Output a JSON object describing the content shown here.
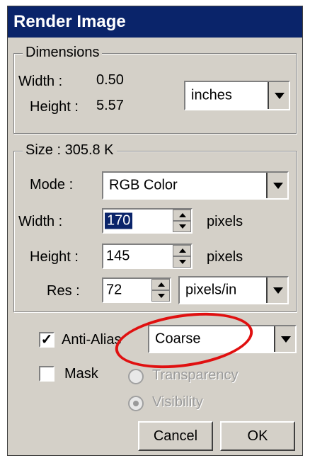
{
  "title": "Render Image",
  "dimensions": {
    "legend": "Dimensions",
    "width_label": "Width :",
    "width_value": "0.50",
    "height_label": "Height :",
    "height_value": "5.57",
    "unit_select": "inches"
  },
  "size": {
    "legend": "Size : 305.8 K",
    "mode_label": "Mode :",
    "mode_value": "RGB Color",
    "width_label": "Width :",
    "width_value": "170",
    "width_unit": "pixels",
    "height_label": "Height :",
    "height_value": "145",
    "height_unit": "pixels",
    "res_label": "Res :",
    "res_value": "72",
    "res_unit_select": "pixels/in"
  },
  "options": {
    "antialias_label": "Anti-Alias",
    "antialias_checked": true,
    "antialias_value": "Coarse",
    "mask_label": "Mask",
    "mask_checked": false,
    "transparency_label": "Transparency",
    "visibility_label": "Visibility"
  },
  "buttons": {
    "cancel": "Cancel",
    "ok": "OK"
  },
  "colors": {
    "titlebar": "#0a246a",
    "highlight_circle": "#e01010"
  }
}
